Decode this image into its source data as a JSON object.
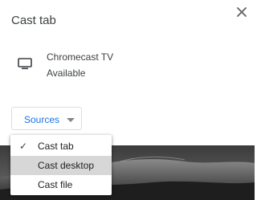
{
  "dialog": {
    "title": "Cast tab",
    "close_icon": "close-icon"
  },
  "sink": {
    "icon": "tv-icon",
    "name": "Chromecast TV",
    "status": "Available"
  },
  "sources": {
    "label": "Sources",
    "caret_icon": "caret-down-icon"
  },
  "menu": {
    "items": [
      {
        "label": "Cast tab",
        "checked": true
      },
      {
        "label": "Cast desktop",
        "checked": false
      },
      {
        "label": "Cast file",
        "checked": false
      }
    ],
    "check_glyph": "✓"
  },
  "colors": {
    "accent": "#1a73e8",
    "menu_highlight": "#d7d7d7"
  }
}
